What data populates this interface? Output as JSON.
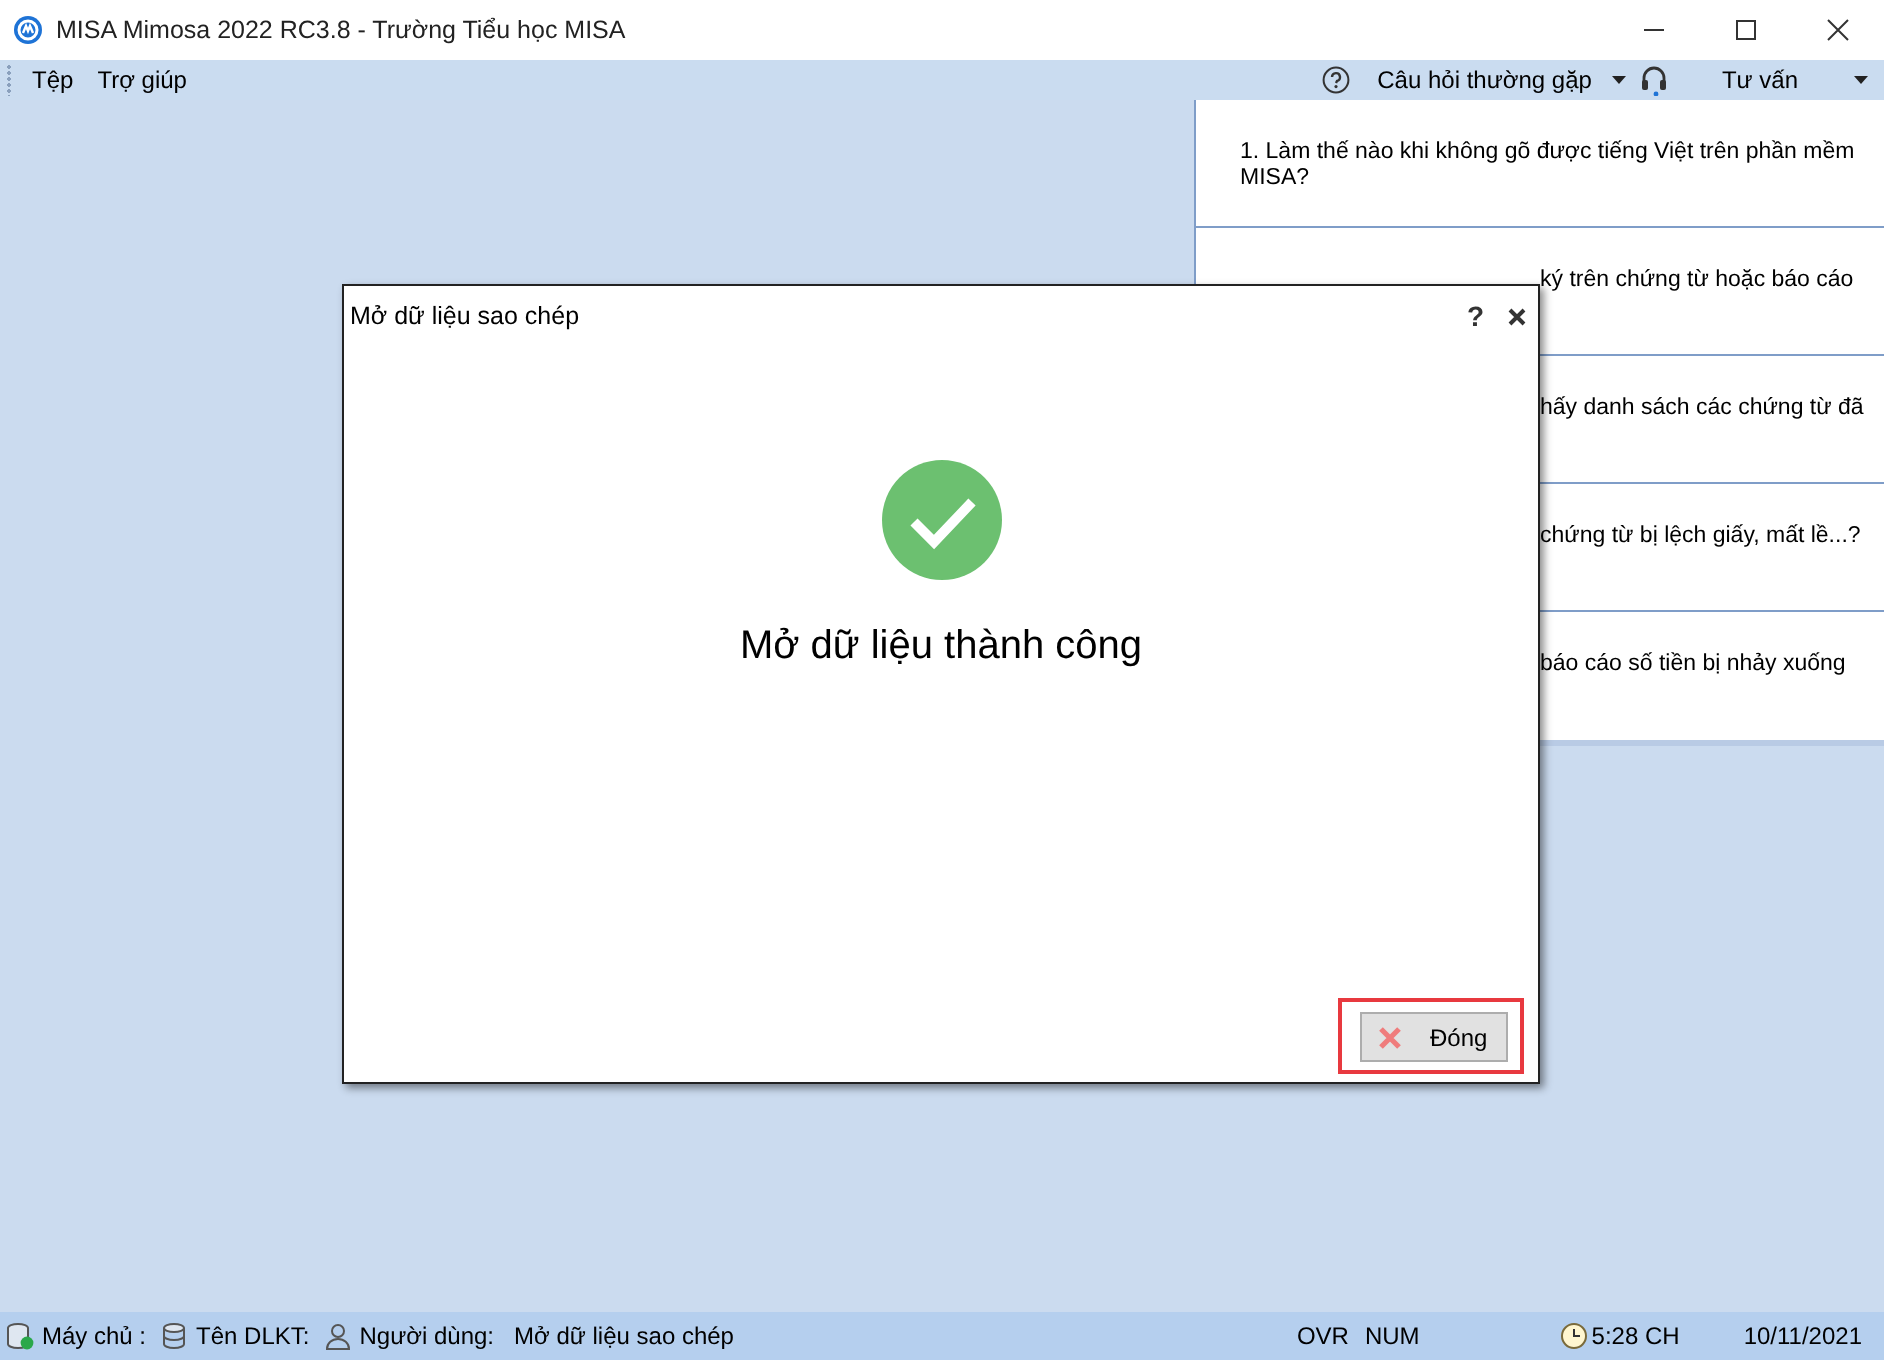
{
  "window": {
    "title": "MISA Mimosa 2022 RC3.8 - Trường Tiểu học MISA"
  },
  "menu": [
    {
      "label": "Tệp"
    },
    {
      "label": "Trợ giúp"
    }
  ],
  "toolbar": {
    "faq_button": "Câu hỏi thường gặp",
    "support_button": "Tư vấn"
  },
  "faq": [
    {
      "kind": "full",
      "text": "1. Làm thế nào khi không gõ được tiếng Việt trên phần mềm MISA?"
    },
    {
      "kind": "partial",
      "text": "ký trên chứng từ hoặc báo cáo"
    },
    {
      "kind": "partial",
      "text": "hấy danh sách các chứng từ đã"
    },
    {
      "kind": "partial",
      "text": "chứng từ bị lệch giấy, mất lề...?"
    },
    {
      "kind": "partial",
      "text": "báo cáo số tiền bị nhảy xuống"
    }
  ],
  "dialog": {
    "title": "Mở dữ liệu sao chép",
    "help": "?",
    "message": "Mở dữ liệu thành công",
    "button": "Đóng",
    "button_highlighted": true
  },
  "status_bar": {
    "server_label": "Máy chủ :",
    "database_label": "Tên DLKT:",
    "user_label": "Người dùng:",
    "user": "Mở dữ liệu sao chép",
    "ovr": "OVR",
    "num": "NUM",
    "time": "5:28 CH",
    "date": "10/11/2021"
  }
}
